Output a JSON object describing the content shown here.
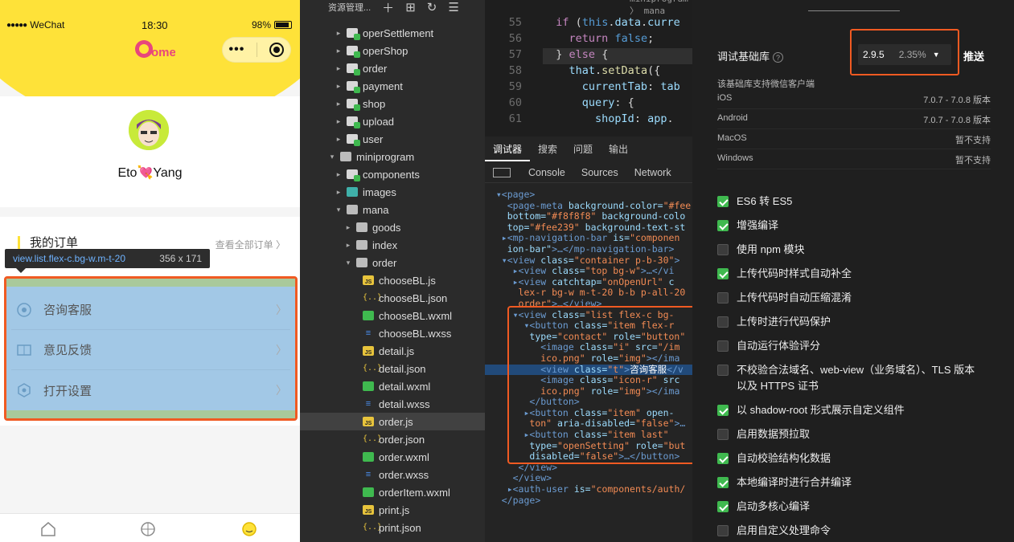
{
  "phone": {
    "carrier": "WeChat",
    "time": "18:30",
    "battery": "98%",
    "logo_text": "ome",
    "username": "Eto💘Yang",
    "orders_title": "我的订单",
    "orders_all": "查看全部订单",
    "tooltip": {
      "selector": "view.list.flex-c.bg-w.m-t-20",
      "size": "356 x 171"
    },
    "list": [
      {
        "label": "咨询客服",
        "icon": "chat-icon"
      },
      {
        "label": "意见反馈",
        "icon": "feedback-icon"
      },
      {
        "label": "打开设置",
        "icon": "settings-icon"
      }
    ],
    "tabbar": [
      "home-icon",
      "discover-icon",
      "profile-icon"
    ]
  },
  "tree": {
    "header": "资源管理...",
    "items": [
      {
        "name": "operSettlement",
        "type": "folder-g",
        "caret": "▸"
      },
      {
        "name": "operShop",
        "type": "folder-g",
        "caret": "▸"
      },
      {
        "name": "order",
        "type": "folder-g",
        "caret": "▸"
      },
      {
        "name": "payment",
        "type": "folder-g",
        "caret": "▸"
      },
      {
        "name": "shop",
        "type": "folder-g",
        "caret": "▸"
      },
      {
        "name": "upload",
        "type": "folder-g",
        "caret": "▸"
      },
      {
        "name": "user",
        "type": "folder-g",
        "caret": "▸"
      },
      {
        "name": "miniprogram",
        "type": "folder-p",
        "caret": "▾"
      },
      {
        "name": "components",
        "type": "folder-g",
        "caret": "▸"
      },
      {
        "name": "images",
        "type": "folder-c",
        "caret": "▸"
      },
      {
        "name": "mana",
        "type": "folder-p",
        "caret": "▾"
      },
      {
        "name": "goods",
        "type": "folder-p",
        "caret": "▸"
      },
      {
        "name": "index",
        "type": "folder-p",
        "caret": "▸"
      },
      {
        "name": "order",
        "type": "folder-p",
        "caret": "▾"
      },
      {
        "name": "chooseBL.js",
        "type": "js",
        "caret": ""
      },
      {
        "name": "chooseBL.json",
        "type": "json",
        "caret": ""
      },
      {
        "name": "chooseBL.wxml",
        "type": "wxml",
        "caret": ""
      },
      {
        "name": "chooseBL.wxss",
        "type": "wxss",
        "caret": ""
      },
      {
        "name": "detail.js",
        "type": "js",
        "caret": ""
      },
      {
        "name": "detail.json",
        "type": "json",
        "caret": ""
      },
      {
        "name": "detail.wxml",
        "type": "wxml",
        "caret": ""
      },
      {
        "name": "detail.wxss",
        "type": "wxss",
        "caret": ""
      },
      {
        "name": "order.js",
        "type": "js",
        "caret": "",
        "selected": true
      },
      {
        "name": "order.json",
        "type": "json",
        "caret": ""
      },
      {
        "name": "order.wxml",
        "type": "wxml",
        "caret": ""
      },
      {
        "name": "order.wxss",
        "type": "wxss",
        "caret": ""
      },
      {
        "name": "orderItem.wxml",
        "type": "wxml",
        "caret": ""
      },
      {
        "name": "print.js",
        "type": "js",
        "caret": ""
      },
      {
        "name": "print.json",
        "type": "json",
        "caret": ""
      }
    ]
  },
  "editor": {
    "breadcrumb": "miniprogram 〉 mana",
    "lines": [
      {
        "no": "55",
        "html": "  <span class='kw2'>if</span> <span class='pu'>(</span><span class='kw'>this</span><span class='pu'>.</span><span class='id'>data</span><span class='pu'>.</span><span class='id'>curre</span>"
      },
      {
        "no": "56",
        "html": "    <span class='kw2'>return</span> <span class='kw'>false</span><span class='pu'>;</span>"
      },
      {
        "no": "57",
        "html": "  <span class='pu'>}</span> <span class='kw2'>else</span> <span class='pu'>{</span>"
      },
      {
        "no": "58",
        "html": "    <span class='id'>that</span><span class='pu'>.</span><span class='fn'>setData</span><span class='pu'>({</span>"
      },
      {
        "no": "59",
        "html": "      <span class='id'>currentTab</span><span class='pu'>:</span> <span class='id'>tab</span>"
      },
      {
        "no": "60",
        "html": "      <span class='id'>query</span><span class='pu'>: {</span>"
      },
      {
        "no": "61",
        "html": "        <span class='id'>shopId</span><span class='pu'>:</span> <span class='id'>app</span><span class='pu'>.</span>"
      }
    ]
  },
  "devtools": {
    "tabs": [
      "调试器",
      "搜索",
      "问题",
      "输出"
    ],
    "panels": [
      "Console",
      "Sources",
      "Network"
    ],
    "dom": [
      "<span class='tg'>▾&lt;page&gt;</span>",
      "  <span class='tg'>&lt;page-meta</span> <span class='at'>background-color=</span><span class='av'>\"#fee</span>",
      "  <span class='at'>bottom=</span><span class='av'>\"#f8f8f8\"</span> <span class='at'>background-colo</span>",
      "  <span class='at'>top=</span><span class='av'>\"#fee239\"</span> <span class='at'>background-text-st</span>",
      " <span class='tg'>▸&lt;mp-navigation-bar</span> <span class='at'>is=</span><span class='av'>\"componen</span>",
      "  <span class='at'>ion-bar\"</span><span class='tg'>&gt;…&lt;/mp-navigation-bar&gt;</span>",
      " <span class='tg'>▾&lt;view</span> <span class='at'>class=</span><span class='av'>\"container p-b-30\"</span><span class='tg'>&gt;</span>",
      "   <span class='tg'>▸&lt;view</span> <span class='at'>class=</span><span class='av'>\"top bg-w\"</span><span class='tg'>&gt;…&lt;/vi</span>",
      "   <span class='tg'>▸&lt;view</span> <span class='at'>catchtap=</span><span class='av'>\"onOpenUrl\"</span> <span class='at'>c</span>",
      "    <span class='av'>lex-r bg-w m-t-20 b-b p-all-20</span>",
      "    <span class='av'>order\"</span><span class='tg'>&gt;…&lt;/view&gt;</span>",
      "   <span class='tg'>▾&lt;view</span> <span class='at'>class=</span><span class='av'>\"list flex-c bg-</span>",
      "     <span class='tg'>▾&lt;button</span> <span class='at'>class=</span><span class='av'>\"item flex-r</span>",
      "      <span class='at'>type=</span><span class='av'>\"contact\"</span> <span class='at'>role=</span><span class='av'>\"button\"</span>",
      "        <span class='tg'>&lt;image</span> <span class='at'>class=</span><span class='av'>\"i\"</span> <span class='at'>src=</span><span class='av'>\"/im</span>",
      "        <span class='av'>ico.png\"</span> <span class='at'>role=</span><span class='av'>\"img\"</span><span class='tg'>&gt;&lt;/ima</span>",
      "        <span class='tg'>&lt;view</span> <span class='at'>class=</span><span class='av'>\"t\"</span><span class='tg'>&gt;</span><span class='tx'>咨询客服</span><span class='tg'>&lt;/v</span>",
      "        <span class='tg'>&lt;image</span> <span class='at'>class=</span><span class='av'>\"icon-r\"</span> <span class='at'>src</span>",
      "        <span class='av'>ico.png\"</span> <span class='at'>role=</span><span class='av'>\"img\"</span><span class='tg'>&gt;&lt;/ima</span>",
      "      <span class='tg'>&lt;/button&gt;</span>",
      "     <span class='tg'>▸&lt;button</span> <span class='at'>class=</span><span class='av'>\"item\"</span> <span class='at'>open-</span>",
      "      <span class='av'>ton\"</span> <span class='at'>aria-disabled=</span><span class='av'>\"false\"</span><span class='tg'>&gt;…</span>",
      "     <span class='tg'>▸&lt;button</span> <span class='at'>class=</span><span class='av'>\"item last\"</span>",
      "      <span class='at'>type=</span><span class='av'>\"openSetting\"</span> <span class='at'>role=</span><span class='av'>\"but</span>",
      "      <span class='at'>disabled=</span><span class='av'>\"false\"</span><span class='tg'>&gt;…&lt;/button&gt;</span>",
      "    <span class='tg'>&lt;/view&gt;</span>",
      "   <span class='tg'>&lt;/view&gt;</span>",
      "  <span class='tg'>▸&lt;auth-user</span> <span class='at'>is=</span><span class='av'>\"components/auth/</span>",
      " <span class='tg'>&lt;/page&gt;</span>"
    ]
  },
  "settings": {
    "lib_label": "调试基础库",
    "lib_version": "2.9.5",
    "lib_percent": "2.35%",
    "push_label": "推送",
    "support_text": "该基础库支持微信客户端",
    "platforms": [
      {
        "name": "iOS",
        "value": "7.0.7 - 7.0.8 版本"
      },
      {
        "name": "Android",
        "value": "7.0.7 - 7.0.8 版本"
      },
      {
        "name": "MacOS",
        "value": "暂不支持"
      },
      {
        "name": "Windows",
        "value": "暂不支持"
      }
    ],
    "checks": [
      {
        "label": "ES6 转 ES5",
        "checked": true
      },
      {
        "label": "增强编译",
        "checked": true
      },
      {
        "label": "使用 npm 模块",
        "checked": false
      },
      {
        "label": "上传代码时样式自动补全",
        "checked": true
      },
      {
        "label": "上传代码时自动压缩混淆",
        "checked": false
      },
      {
        "label": "上传时进行代码保护",
        "checked": false
      },
      {
        "label": "自动运行体验评分",
        "checked": false
      },
      {
        "label": "不校验合法域名、web-view（业务域名）、TLS 版本以及 HTTPS 证书",
        "checked": false
      },
      {
        "label": "以 shadow-root 形式展示自定义组件",
        "checked": true
      },
      {
        "label": "启用数据预拉取",
        "checked": false
      },
      {
        "label": "自动校验结构化数据",
        "checked": true
      },
      {
        "label": "本地编译时进行合并编译",
        "checked": true
      },
      {
        "label": "启动多核心编译",
        "checked": true
      },
      {
        "label": "启用自定义处理命令",
        "checked": false
      }
    ]
  },
  "colors": {
    "accent": "#fee239",
    "highlight": "#f05a22",
    "check": "#3fb94f"
  }
}
